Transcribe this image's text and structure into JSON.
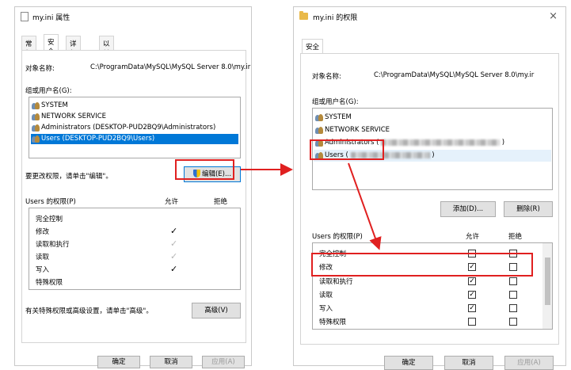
{
  "colors": {
    "accent": "#0078d7",
    "annotation": "#e02020"
  },
  "left_dialog": {
    "title": "my.ini 属性",
    "tabs": [
      "常规",
      "安全",
      "详细信息",
      "以前的版本"
    ],
    "active_tab": "安全",
    "object_name_label": "对象名称:",
    "object_name_value": "C:\\ProgramData\\MySQL\\MySQL Server 8.0\\my.ir",
    "groups_label": "组或用户名(G):",
    "users": [
      "SYSTEM",
      "NETWORK SERVICE",
      "Administrators (DESKTOP-PUD2BQ9\\Administrators)",
      "Users (DESKTOP-PUD2BQ9\\Users)"
    ],
    "selected_user_index": 3,
    "edit_hint": "要更改权限，请单击\"编辑\"。",
    "edit_button": "编辑(E)...",
    "perms_header": "Users 的权限(P)",
    "allow_header": "允许",
    "deny_header": "拒绝",
    "permissions": [
      {
        "name": "完全控制",
        "allow": ""
      },
      {
        "name": "修改",
        "allow": "✓"
      },
      {
        "name": "读取和执行",
        "allow": "✓"
      },
      {
        "name": "读取",
        "allow": "✓"
      },
      {
        "name": "写入",
        "allow": "✓"
      },
      {
        "name": "特殊权限",
        "allow": ""
      }
    ],
    "advanced_hint": "有关特殊权限或高级设置，请单击\"高级\"。",
    "advanced_button": "高级(V)",
    "ok_button": "确定",
    "cancel_button": "取消",
    "apply_button": "应用(A)"
  },
  "right_dialog": {
    "title": "my.ini 的权限",
    "close_icon": "×",
    "tab": "安全",
    "object_name_label": "对象名称:",
    "object_name_value": "C:\\ProgramData\\MySQL\\MySQL Server 8.0\\my.ir",
    "groups_label": "组或用户名(G):",
    "users": [
      {
        "name": "SYSTEM"
      },
      {
        "name": "NETWORK SERVICE"
      },
      {
        "name": "Administrators ("
      },
      {
        "name": "Users ("
      }
    ],
    "users_suffix": ")",
    "add_button": "添加(D)...",
    "remove_button": "删除(R)",
    "perms_header": "Users 的权限(P)",
    "allow_header": "允许",
    "deny_header": "拒绝",
    "permissions": [
      {
        "name": "完全控制",
        "allow": "",
        "deny": ""
      },
      {
        "name": "修改",
        "allow": "✓",
        "deny": ""
      },
      {
        "name": "读取和执行",
        "allow": "✓",
        "deny": ""
      },
      {
        "name": "读取",
        "allow": "✓",
        "deny": ""
      },
      {
        "name": "写入",
        "allow": "✓",
        "deny": ""
      },
      {
        "name": "特殊权限",
        "allow": "",
        "deny": ""
      }
    ],
    "ok_button": "确定",
    "cancel_button": "取消",
    "apply_button": "应用(A)"
  }
}
